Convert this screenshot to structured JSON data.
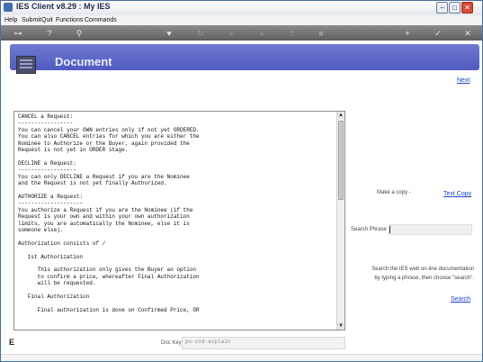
{
  "window": {
    "title": "IES Client v8.29 : My IES"
  },
  "menu": [
    "Help",
    "Submit",
    "Quit",
    "Functions",
    "Commands"
  ],
  "toolbar_icons": [
    "key-icon",
    "help-icon",
    "search-icon",
    "heart-icon",
    "refresh-icon",
    "rewind-icon",
    "fast-forward-icon",
    "upload-icon",
    "stop-icon",
    "plus-icon",
    "check-icon",
    "close-icon"
  ],
  "header": {
    "title": "Document",
    "next_link": "Next"
  },
  "document": {
    "lines": [
      "CANCEL a Request:",
      "-----------------",
      "You can cancel your OWN entries only if not yet ORDERED.",
      "You can also CANCEL entries for which you are either the",
      "Nominee to Authorize or the Buyer, again provided the",
      "Request is not yet in ORDER stage.",
      "",
      "DECLINE a Request:",
      "------------------",
      "You can only DECLINE a Request if you are the Nominee",
      "and the Request is not yet finally Authorized.",
      "",
      "AUTHORIZE a Request:",
      "--------------------",
      "You authorize a Request if you are the Nominee (if the",
      "Request is your own and within your own authorization",
      "limits, you are automatically the Nominee, else it is",
      "someone else).",
      "",
      "Authorization consists of /",
      "",
      "   1st Authorization",
      "",
      "      This authorization only gives the Buyer an option",
      "      to confirm a price, whereafter Final Authorization",
      "      will be requested.",
      "",
      "   Final Authorization",
      "",
      "      Final authorization is done on Confirmed Price, OR"
    ]
  },
  "side": {
    "make_copy_label": "Make a copy -",
    "text_copy_link": "Text Copy",
    "search_label": "Search Phrase",
    "search_value": "",
    "help_line1": "Search the IES web on-line documentation",
    "help_line2": "by typing a phrase, then choose \"search\".",
    "search_link": "Search"
  },
  "footer": {
    "mark": "E",
    "doc_key_label": "Doc Key",
    "doc_key_value": "ps-cod-explain"
  }
}
